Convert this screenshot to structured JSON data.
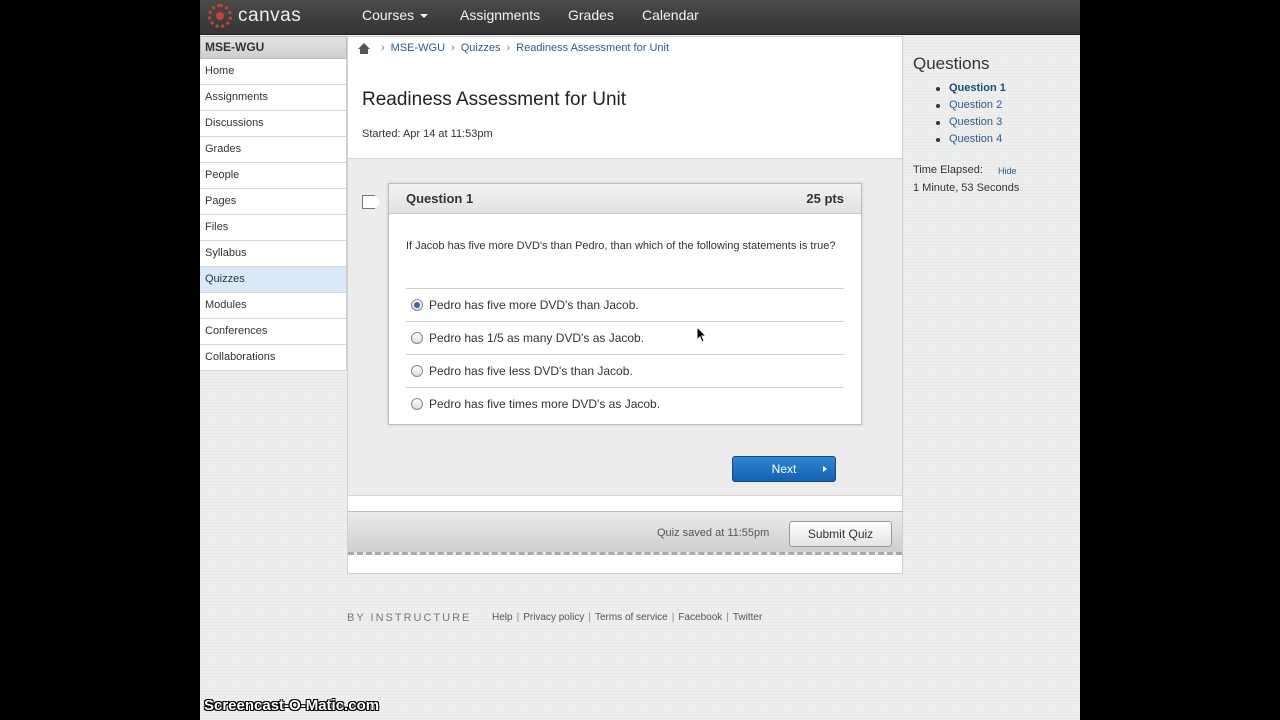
{
  "brand": {
    "name": "canvas"
  },
  "topnav": {
    "items": [
      {
        "label": "Courses"
      },
      {
        "label": "Assignments"
      },
      {
        "label": "Grades"
      },
      {
        "label": "Calendar"
      }
    ]
  },
  "sidebar": {
    "course": "MSE-WGU",
    "items": [
      {
        "label": "Home"
      },
      {
        "label": "Assignments"
      },
      {
        "label": "Discussions"
      },
      {
        "label": "Grades"
      },
      {
        "label": "People"
      },
      {
        "label": "Pages"
      },
      {
        "label": "Files"
      },
      {
        "label": "Syllabus"
      },
      {
        "label": "Quizzes"
      },
      {
        "label": "Modules"
      },
      {
        "label": "Conferences"
      },
      {
        "label": "Collaborations"
      }
    ],
    "active": "Quizzes"
  },
  "breadcrumb": [
    "MSE-WGU",
    "Quizzes",
    "Readiness Assessment for Unit"
  ],
  "quiz": {
    "title": "Readiness Assessment for Unit",
    "started": "Started: Apr 14 at 11:53pm",
    "question": {
      "name": "Question 1",
      "points": "25 pts",
      "text": "If Jacob has five more DVD's than Pedro, than which of the following statements is true?",
      "answers": [
        {
          "text": "Pedro has five more DVD's than Jacob.",
          "selected": true
        },
        {
          "text": "Pedro has 1/5 as many DVD's as Jacob.",
          "selected": false
        },
        {
          "text": "Pedro has five less DVD's than Jacob.",
          "selected": false
        },
        {
          "text": "Pedro has five times more DVD's as Jacob.",
          "selected": false
        }
      ]
    },
    "next_label": "Next",
    "saved_text": "Quiz saved at 11:55pm",
    "submit_label": "Submit Quiz"
  },
  "right": {
    "heading": "Questions",
    "questions": [
      "Question 1",
      "Question 2",
      "Question 3",
      "Question 4"
    ],
    "current": "Question 1",
    "elapsed_label": "Time Elapsed:",
    "hide_label": "Hide",
    "elapsed_value": "1 Minute, 53 Seconds"
  },
  "footer": {
    "brand": "BY INSTRUCTURE",
    "links": [
      "Help",
      "Privacy policy",
      "Terms of service",
      "Facebook",
      "Twitter"
    ]
  },
  "watermark": "Screencast-O-Matic.com",
  "colors": {
    "link": "#2d5b8a",
    "primary_button": "#1f72c4",
    "logo": "#c9423a",
    "active_nav": "#d9e9f7"
  }
}
